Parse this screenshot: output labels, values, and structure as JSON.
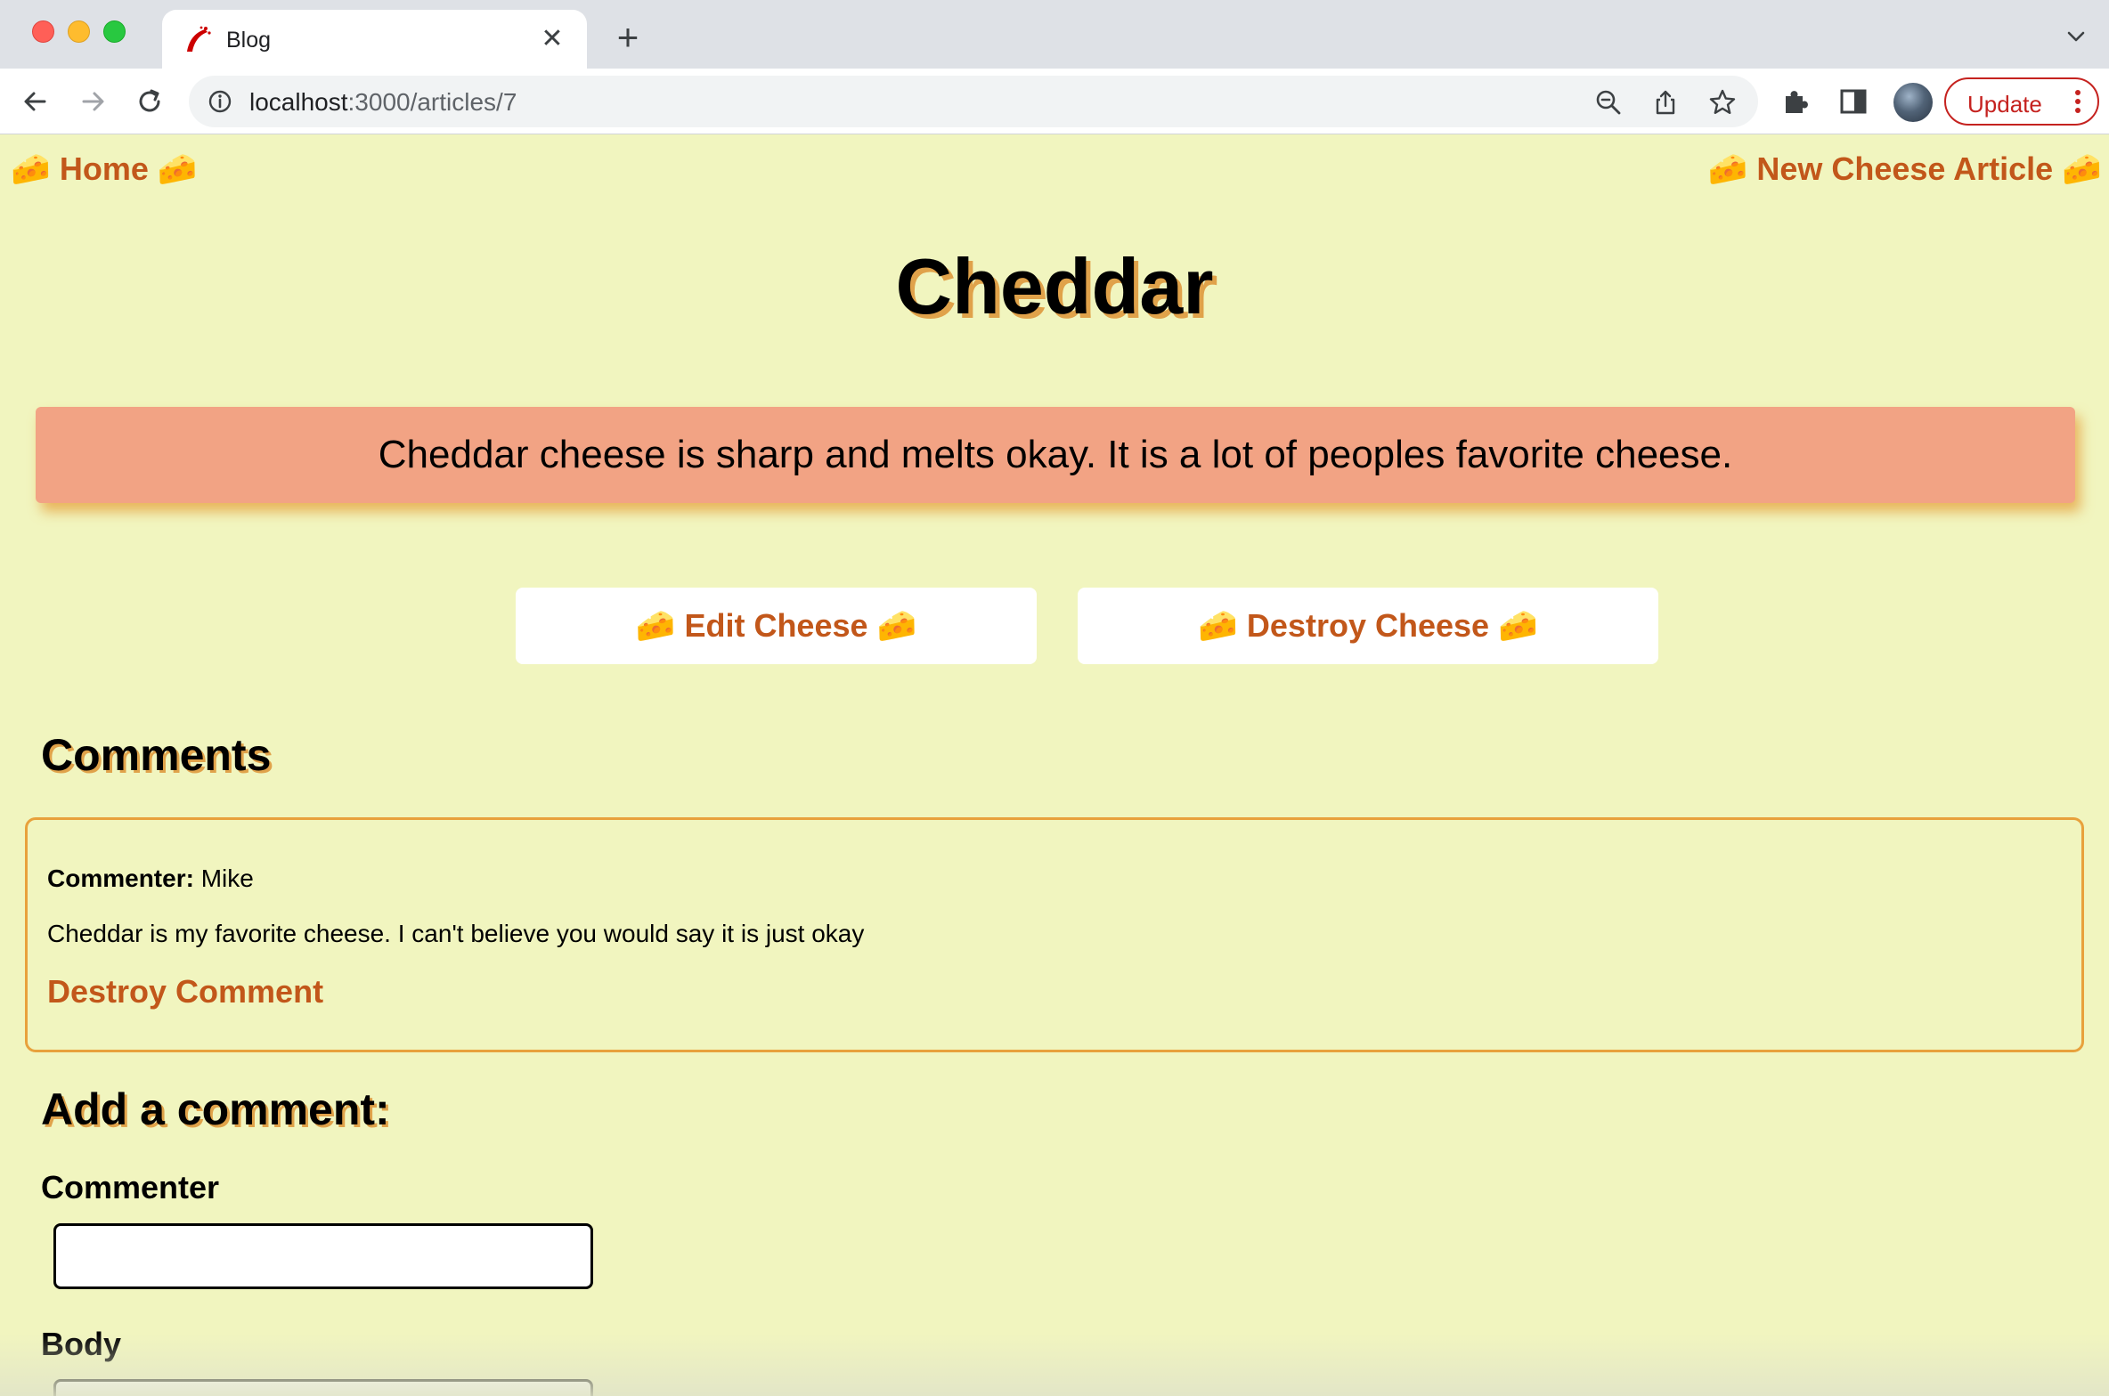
{
  "browser": {
    "tab_title": "Blog",
    "url_host": "localhost",
    "url_path": ":3000/articles/7",
    "update_label": "Update",
    "new_tab_symbol": "+",
    "close_symbol": "✕",
    "icons": [
      "back-arrow-icon",
      "forward-arrow-icon",
      "reload-icon",
      "info-icon",
      "zoom-icon",
      "share-icon",
      "bookmark-star-icon",
      "extensions-icon",
      "side-panel-icon",
      "profile-avatar",
      "more-menu-icon",
      "tab-list-chevron-icon"
    ]
  },
  "nav": {
    "home_emoji_left": "🧀",
    "home_label": "Home",
    "home_emoji_right": "🧀",
    "new_emoji_left": "🧀",
    "new_label": "New Cheese Article",
    "new_emoji_right": "🧀"
  },
  "article": {
    "title": "Cheddar",
    "body": "Cheddar cheese is sharp and melts okay. It is a lot of peoples favorite cheese."
  },
  "actions": {
    "edit_label": "🧀 Edit Cheese 🧀",
    "destroy_label": "🧀 Destroy Cheese 🧀"
  },
  "comments": {
    "heading": "Comments",
    "items": [
      {
        "commenter_label": "Commenter:",
        "commenter": "Mike",
        "body": "Cheddar is my favorite cheese. I can't believe you would say it is just okay",
        "destroy_label": "Destroy Comment"
      }
    ]
  },
  "form": {
    "heading": "Add a comment:",
    "commenter_label": "Commenter",
    "commenter_value": "",
    "body_label": "Body"
  },
  "colors": {
    "page_bg": "#f1f5bf",
    "link": "#c2571a",
    "callout_bg": "#f2a384",
    "accent_border": "#e8a13c",
    "update_red": "#c5221f"
  }
}
